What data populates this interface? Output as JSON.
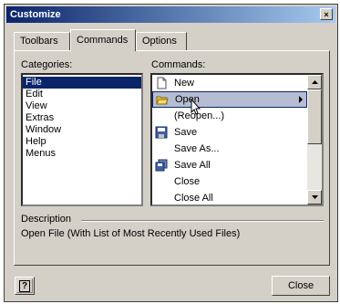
{
  "window": {
    "title": "Customize",
    "close_glyph": "×"
  },
  "tabs": [
    {
      "label": "Toolbars",
      "active": false
    },
    {
      "label": "Commands",
      "active": true
    },
    {
      "label": "Options",
      "active": false
    }
  ],
  "categories": {
    "label": "Categories:",
    "items": [
      "File",
      "Edit",
      "View",
      "Extras",
      "Window",
      "Help",
      "Menus"
    ],
    "selected": "File"
  },
  "commands": {
    "label": "Commands:",
    "items": [
      {
        "label": "New",
        "icon": "new-document-icon"
      },
      {
        "label": "Open",
        "icon": "open-folder-icon",
        "selected": true,
        "submenu": true
      },
      {
        "label": "(Reopen...)",
        "icon": ""
      },
      {
        "label": "Save",
        "icon": "save-disk-icon"
      },
      {
        "label": "Save As...",
        "icon": ""
      },
      {
        "label": "Save All",
        "icon": "save-all-icon"
      },
      {
        "label": "Close",
        "icon": ""
      },
      {
        "label": "Close All",
        "icon": ""
      }
    ]
  },
  "description": {
    "label": "Description",
    "text": "Open File (With List of Most Recently Used Files)"
  },
  "buttons": {
    "help_glyph": "?",
    "close": "Close"
  },
  "colors": {
    "title_start": "#0a246a",
    "title_end": "#a6caf0",
    "face": "#d4d0c8",
    "selection": "#0a246a"
  }
}
